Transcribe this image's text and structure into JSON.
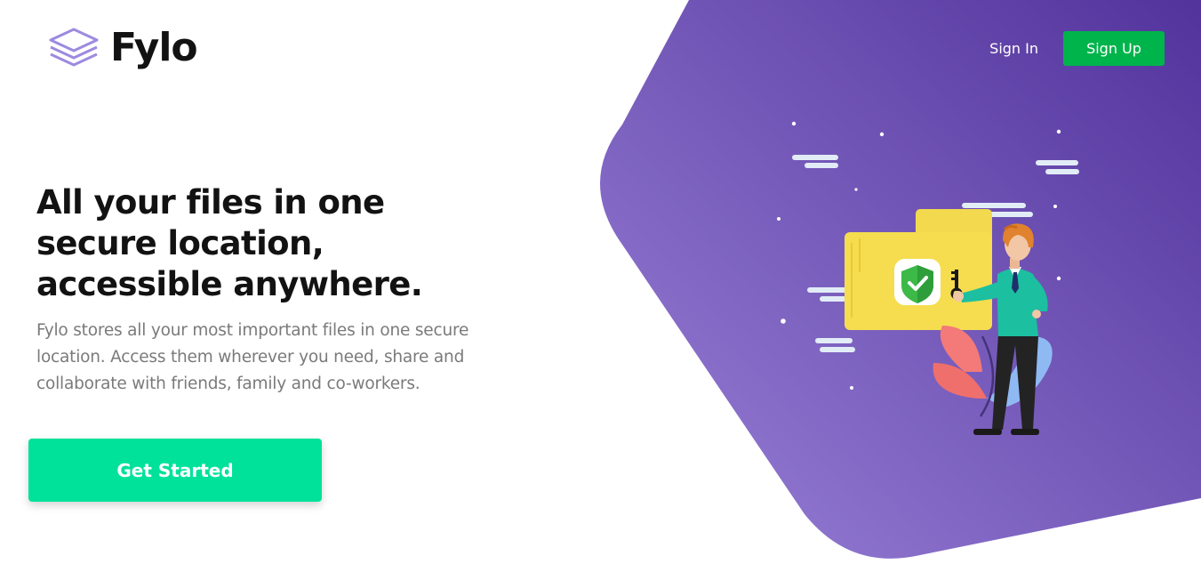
{
  "brand": {
    "name": "Fylo",
    "logo_icon": "stacked-layers-icon"
  },
  "nav": {
    "sign_in": "Sign In",
    "sign_up": "Sign Up"
  },
  "hero": {
    "title": "All your files in one secure location, accessible anywhere.",
    "description": "Fylo stores all your most important files in one secure location. Access them wherever you need, share and collaborate with friends, family and co-workers.",
    "cta": "Get Started"
  },
  "illustration": {
    "subject": "person-holding-key-with-secure-folder",
    "icons": [
      "folder-icon",
      "shield-check-icon",
      "key-icon",
      "plant-icon"
    ]
  },
  "colors": {
    "purple_light": "#8f76d3",
    "purple_dark": "#5535a0",
    "signup_green": "#00b44c",
    "cta_green": "#00e29a",
    "title_text": "#121212",
    "body_text": "#7a7a7a"
  }
}
